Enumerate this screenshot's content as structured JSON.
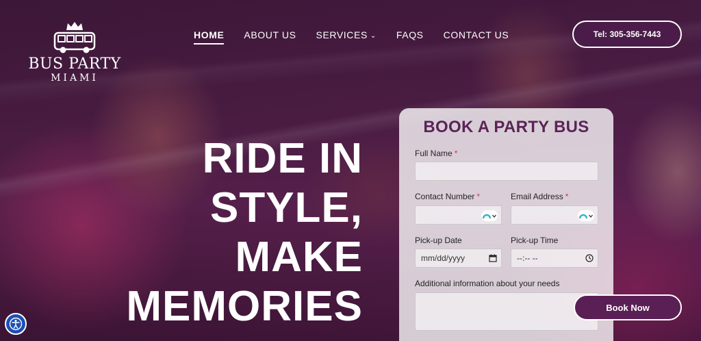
{
  "logo": {
    "title": "BUS PARTY",
    "subtitle": "MIAMI",
    "icon": "crown-bus-icon"
  },
  "nav": {
    "items": [
      {
        "label": "HOME",
        "active": true
      },
      {
        "label": "ABOUT US",
        "active": false
      },
      {
        "label": "SERVICES",
        "active": false,
        "dropdown": true
      },
      {
        "label": "FAQS",
        "active": false
      },
      {
        "label": "CONTACT US",
        "active": false
      }
    ]
  },
  "header": {
    "tel_label": "Tel: 305-356-7443"
  },
  "hero": {
    "line1": "RIDE IN",
    "line2": "STYLE,",
    "line3": "MAKE",
    "line4": "MEMORIES"
  },
  "form": {
    "title": "BOOK A PARTY BUS",
    "full_name_label": "Full Name",
    "contact_label": "Contact Number",
    "email_label": "Email Address",
    "required_mark": "*",
    "pickup_date_label": "Pick-up Date",
    "pickup_date_value": "mm/dd/yyyy",
    "pickup_time_label": "Pick-up Time",
    "pickup_time_value": "--:-- --",
    "additional_label": "Additional information about your needs",
    "submit_label": "Book Now"
  },
  "colors": {
    "brand": "#5a2457",
    "button": "#4b1c4a",
    "required": "#d23b3b",
    "accessibility": "#1d4fb5"
  },
  "icons": {
    "accessibility": "accessibility-icon",
    "calendar": "calendar-icon",
    "clock": "clock-icon",
    "emoji": "emoji-picker-icon"
  }
}
